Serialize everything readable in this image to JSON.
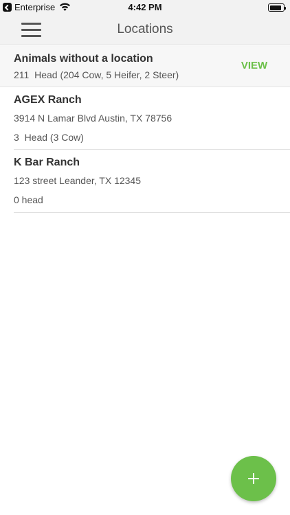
{
  "status_bar": {
    "carrier": "Enterprise",
    "time": "4:42 PM",
    "icons": [
      "back-to-app-icon",
      "wifi-icon",
      "battery-icon"
    ],
    "battery_level": 0.85
  },
  "nav": {
    "title": "Locations",
    "menu_icon": "hamburger-menu-icon"
  },
  "unassigned": {
    "title": "Animals without a location",
    "summary": "211  Head (204 Cow, 5 Heifer, 2 Steer)",
    "action_label": "VIEW"
  },
  "locations": [
    {
      "name": "AGEX Ranch",
      "address": "3914 N Lamar Blvd Austin, TX 78756",
      "head_count": "3  Head (3 Cow)"
    },
    {
      "name": "K Bar Ranch",
      "address": "123 street Leander, TX 12345",
      "head_count": "0 head"
    }
  ],
  "fab": {
    "icon": "plus-icon"
  },
  "colors": {
    "accent": "#6cc04a",
    "nav_background": "#f2f2f2",
    "text_primary": "#333333",
    "text_secondary": "#555555"
  }
}
